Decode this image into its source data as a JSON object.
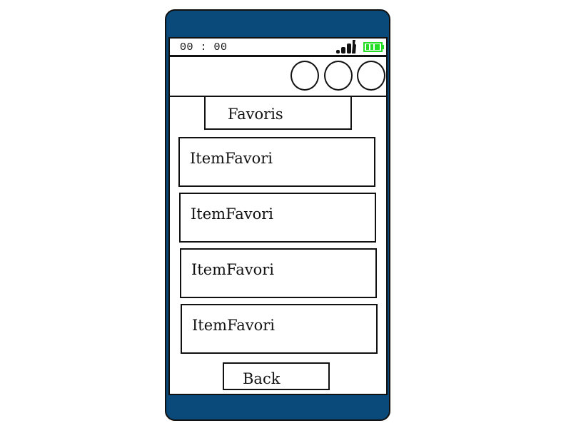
{
  "status_bar": {
    "time": "00 : 00",
    "signal_icon": "signal-strength-icon",
    "battery_icon": "battery-icon",
    "battery_color": "#22dd22"
  },
  "toolbar": {
    "buttons": [
      {
        "icon": "circle-button"
      },
      {
        "icon": "circle-button"
      },
      {
        "icon": "circle-button"
      }
    ]
  },
  "page": {
    "title": "Favoris"
  },
  "favorites": {
    "items": [
      {
        "label": "ItemFavori"
      },
      {
        "label": "ItemFavori"
      },
      {
        "label": "ItemFavori"
      },
      {
        "label": "ItemFavori"
      }
    ]
  },
  "footer": {
    "back_label": "Back"
  },
  "colors": {
    "phone_frame": "#0a4a7b",
    "outline": "#111111",
    "screen": "#ffffff"
  }
}
